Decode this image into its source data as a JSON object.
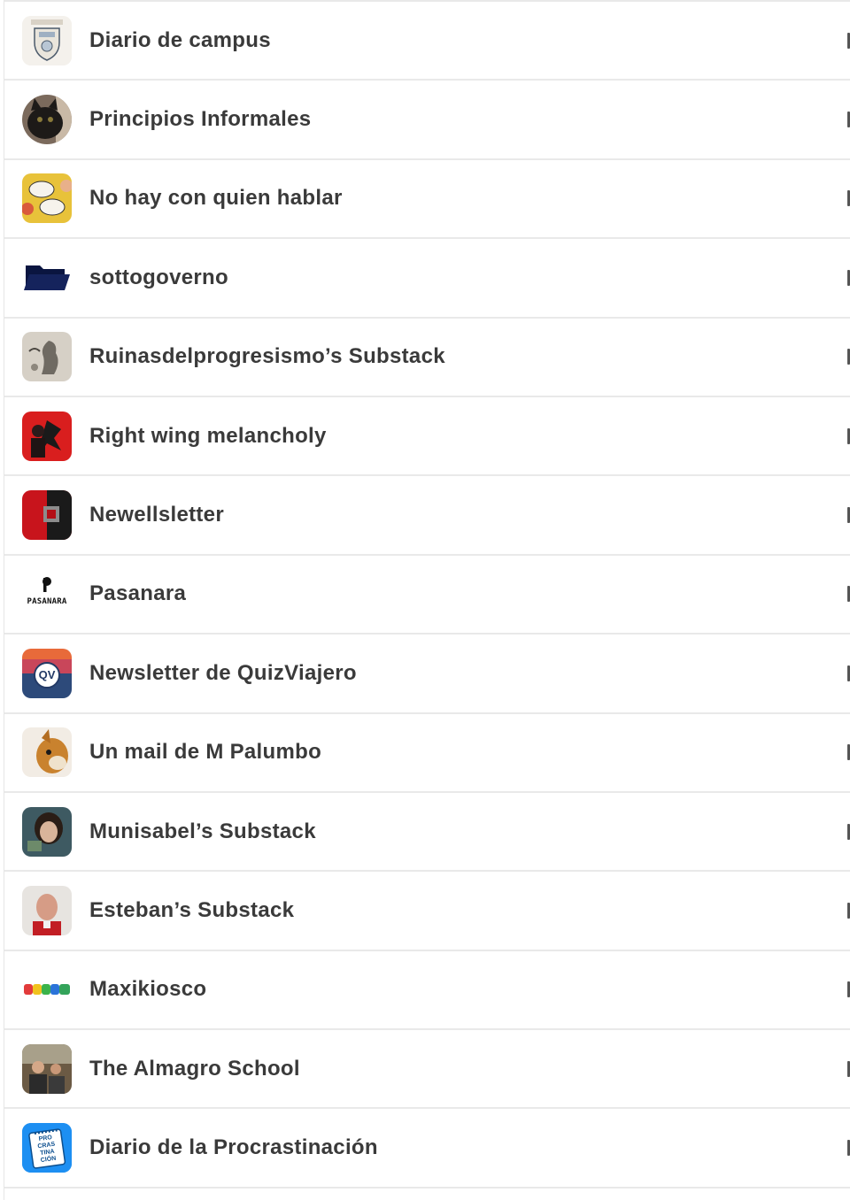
{
  "subscriptions": [
    {
      "name": "Diario de campus",
      "icon": "campus-crest-icon"
    },
    {
      "name": "Principios Informales",
      "icon": "black-cat-icon"
    },
    {
      "name": "No hay con quien hablar",
      "icon": "comic-speech-bubbles-icon"
    },
    {
      "name": "sottogoverno",
      "icon": "folder-icon"
    },
    {
      "name": "Ruinasdelprogresismo’s Substack",
      "icon": "statue-engraving-icon"
    },
    {
      "name": "Right wing melancholy",
      "icon": "red-eagle-flag-icon"
    },
    {
      "name": "Newellsletter",
      "icon": "red-black-shirt-icon"
    },
    {
      "name": "Pasanara",
      "icon": "pasanara-logo-icon"
    },
    {
      "name": "Newsletter de QuizViajero",
      "icon": "quizviajero-logo-icon"
    },
    {
      "name": "Un mail de M Palumbo",
      "icon": "chihuahua-icon"
    },
    {
      "name": "Munisabel’s Substack",
      "icon": "woman-portrait-icon"
    },
    {
      "name": "Esteban’s Substack",
      "icon": "man-portrait-icon"
    },
    {
      "name": "Maxikiosco",
      "icon": "rainbow-blocks-icon"
    },
    {
      "name": "The Almagro School",
      "icon": "group-photo-icon"
    },
    {
      "name": "Diario de la Procrastinación",
      "icon": "notepad-icon"
    }
  ],
  "logo_text": {
    "pasanara": "PASANARA",
    "quizviajero": "QV",
    "procrastinacion": "PRO CRAS TINA CIÓN"
  },
  "colors": {
    "title_text": "#3a3a3a",
    "divider": "#e9e9e9",
    "folder_blue": "#0e1a4a",
    "procrastinacion_blue": "#1d8ff2"
  }
}
